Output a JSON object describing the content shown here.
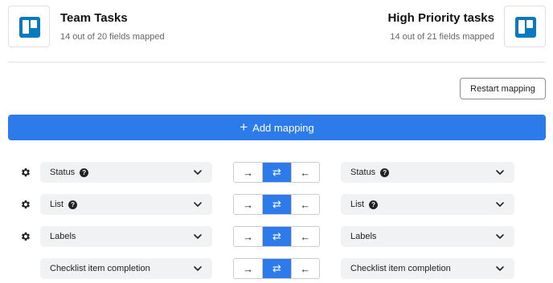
{
  "source": {
    "title": "Team Tasks",
    "subtitle": "14 out of 20 fields mapped",
    "logo_icon": "trello-icon"
  },
  "target": {
    "title": "High Priority tasks",
    "subtitle": "14 out of 21 fields mapped",
    "logo_icon": "trello-icon"
  },
  "actions": {
    "restart_label": "Restart mapping",
    "add_label": "Add mapping",
    "add_icon": "+"
  },
  "direction_glyphs": {
    "left_to_right": "→",
    "both": "⇄",
    "right_to_left": "←"
  },
  "mappings": [
    {
      "left": "Status",
      "right": "Status",
      "help": true,
      "gear": true,
      "direction": "both"
    },
    {
      "left": "List",
      "right": "List",
      "help": true,
      "gear": true,
      "direction": "both"
    },
    {
      "left": "Labels",
      "right": "Labels",
      "help": false,
      "gear": true,
      "direction": "both"
    },
    {
      "left": "Checklist item completion",
      "right": "Checklist item completion",
      "help": false,
      "gear": false,
      "direction": "both"
    }
  ],
  "colors": {
    "accent": "#2d7bea",
    "trello": "#0a79bf",
    "field_bg": "#f1f2f4"
  }
}
